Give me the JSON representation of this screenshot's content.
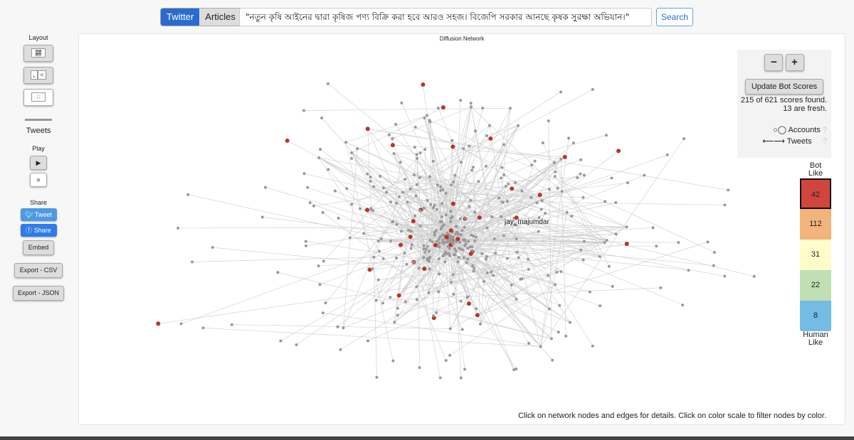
{
  "header": {
    "tabs": [
      {
        "label": "Twitter",
        "active": true
      },
      {
        "label": "Articles",
        "active": false
      }
    ],
    "query": "\"নতুন কৃষি আইনের দ্বারা কৃষিজ পণ্য বিক্রি করা হবে আরও সহজ। বিজেপি সরকার আনছে কৃষক সুরক্ষা অভিযান।\"",
    "search_label": "Search"
  },
  "sidebar": {
    "layout_label": "Layout",
    "tweets_label": "Tweets",
    "play_label": "Play",
    "share_label": "Share",
    "tweet_btn": "Tweet",
    "share_btn": "Share",
    "embed_btn": "Embed",
    "export_csv": "Export - CSV",
    "export_json": "Export - JSON"
  },
  "panel": {
    "title": "Diffusion Network",
    "node_label": "jay_majumdar",
    "hint": "Click on network nodes and edges for details. Click on color scale to filter nodes by color."
  },
  "controls": {
    "zoom_out": "−",
    "zoom_in": "+",
    "update_label": "Update Bot Scores",
    "scores_line1": "215 of 621 scores found.",
    "scores_line2": "13 are fresh.",
    "accounts_label": "Accounts",
    "tweets_label": "Tweets"
  },
  "scale": {
    "top_label": "Bot Like",
    "bottom_label": "Human Like",
    "bins": [
      {
        "count": "42",
        "color": "#d0463f"
      },
      {
        "count": "112",
        "color": "#f2b47a"
      },
      {
        "count": "31",
        "color": "#fffccc"
      },
      {
        "count": "22",
        "color": "#c0e0b4"
      },
      {
        "count": "8",
        "color": "#73bce4"
      }
    ]
  }
}
